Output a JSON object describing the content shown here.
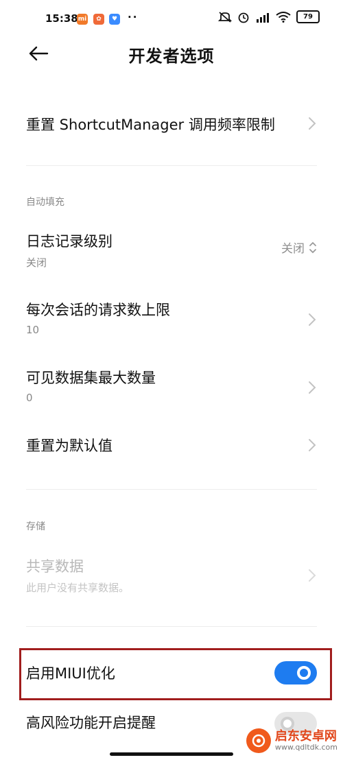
{
  "status_bar": {
    "time": "15:38",
    "app_badges": [
      "mi",
      "app",
      "app"
    ],
    "more": "··",
    "battery": "79"
  },
  "header": {
    "title": "开发者选项"
  },
  "items": {
    "reset_shortcut": {
      "title": "重置 ShortcutManager 调用频率限制"
    },
    "autofill_section": "自动填充",
    "log_level": {
      "title": "日志记录级别",
      "subtitle": "关闭",
      "value": "关闭"
    },
    "max_requests": {
      "title": "每次会话的请求数上限",
      "subtitle": "10"
    },
    "max_datasets": {
      "title": "可见数据集最大数量",
      "subtitle": "0"
    },
    "reset_default": {
      "title": "重置为默认值"
    },
    "storage_section": "存储",
    "shared_data": {
      "title": "共享数据",
      "subtitle": "此用户没有共享数据。"
    },
    "miui_optimize": {
      "title": "启用MIUI优化",
      "enabled": true
    },
    "high_risk_alert": {
      "title": "高风险功能开启提醒",
      "enabled": false
    }
  },
  "watermark": {
    "name": "启东安卓网",
    "url": "www.qdltdk.com"
  },
  "colors": {
    "accent": "#1e7cf0",
    "highlight": "#a11d1d",
    "subtext": "#888888"
  }
}
